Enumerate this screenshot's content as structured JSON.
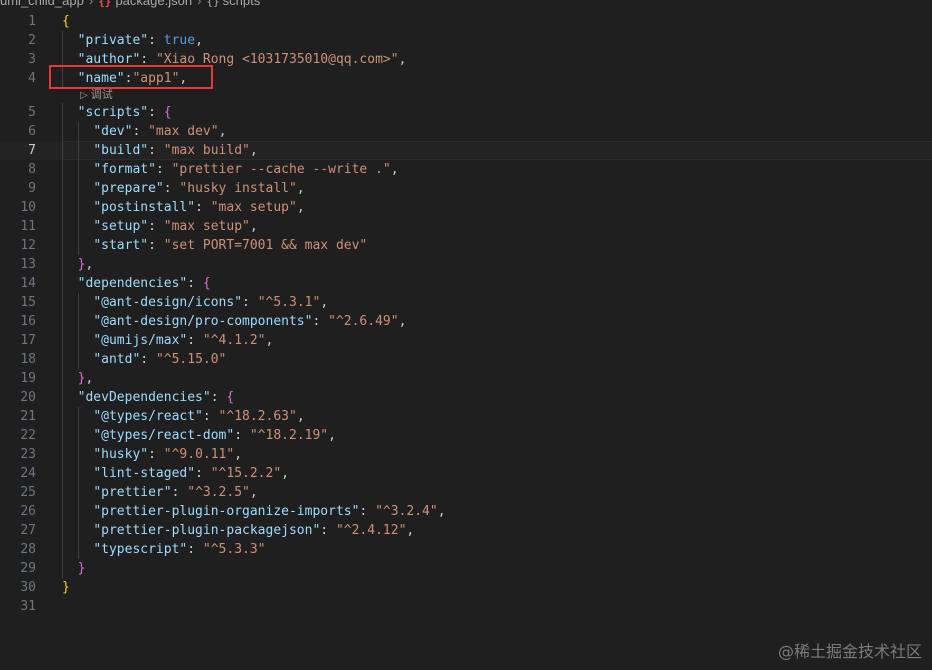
{
  "breadcrumb": {
    "folder": "umi_child_app",
    "file": "package.json",
    "symbol": "scripts"
  },
  "codelens": {
    "label": "调试"
  },
  "watermark": "@稀土掘金技术社区",
  "current_line": 7,
  "highlight_color": "#e53935",
  "lines": [
    {
      "n": "1",
      "html": "<span class='b1'>{</span>"
    },
    {
      "n": "2",
      "html": "  <span class='key'>\"private\"</span><span class='p'>: </span><span class='kw'>true</span><span class='p'>,</span>"
    },
    {
      "n": "3",
      "html": "  <span class='key'>\"author\"</span><span class='p'>: </span><span class='str'>\"Xiao Rong &lt;1031735010@qq.com&gt;\"</span><span class='p'>,</span>"
    },
    {
      "n": "4",
      "html": "  <span class='key'>\"name\"</span><span class='p'>:</span><span class='str'>\"app1\"</span><span class='p'>,</span>"
    },
    {
      "lens": true
    },
    {
      "n": "5",
      "html": "  <span class='key'>\"scripts\"</span><span class='p'>: </span><span class='b2'>{</span>"
    },
    {
      "n": "6",
      "html": "    <span class='key'>\"dev\"</span><span class='p'>: </span><span class='str'>\"max dev\"</span><span class='p'>,</span>"
    },
    {
      "n": "7",
      "html": "    <span class='key'>\"build\"</span><span class='p'>: </span><span class='str'>\"max build\"</span><span class='p'>,</span>"
    },
    {
      "n": "8",
      "html": "    <span class='key'>\"format\"</span><span class='p'>: </span><span class='str'>\"prettier --cache --write .\"</span><span class='p'>,</span>"
    },
    {
      "n": "9",
      "html": "    <span class='key'>\"prepare\"</span><span class='p'>: </span><span class='str'>\"husky install\"</span><span class='p'>,</span>"
    },
    {
      "n": "10",
      "html": "    <span class='key'>\"postinstall\"</span><span class='p'>: </span><span class='str'>\"max setup\"</span><span class='p'>,</span>"
    },
    {
      "n": "11",
      "html": "    <span class='key'>\"setup\"</span><span class='p'>: </span><span class='str'>\"max setup\"</span><span class='p'>,</span>"
    },
    {
      "n": "12",
      "html": "    <span class='key'>\"start\"</span><span class='p'>: </span><span class='str'>\"set PORT=7001 &amp;&amp; max dev\"</span>"
    },
    {
      "n": "13",
      "html": "  <span class='b2'>}</span><span class='p'>,</span>"
    },
    {
      "n": "14",
      "html": "  <span class='key'>\"dependencies\"</span><span class='p'>: </span><span class='b2'>{</span>"
    },
    {
      "n": "15",
      "html": "    <span class='key'>\"@ant-design/icons\"</span><span class='p'>: </span><span class='str'>\"^5.3.1\"</span><span class='p'>,</span>"
    },
    {
      "n": "16",
      "html": "    <span class='key'>\"@ant-design/pro-components\"</span><span class='p'>: </span><span class='str'>\"^2.6.49\"</span><span class='p'>,</span>"
    },
    {
      "n": "17",
      "html": "    <span class='key'>\"@umijs/max\"</span><span class='p'>: </span><span class='str'>\"^4.1.2\"</span><span class='p'>,</span>"
    },
    {
      "n": "18",
      "html": "    <span class='key'>\"antd\"</span><span class='p'>: </span><span class='str'>\"^5.15.0\"</span>"
    },
    {
      "n": "19",
      "html": "  <span class='b2'>}</span><span class='p'>,</span>"
    },
    {
      "n": "20",
      "html": "  <span class='key'>\"devDependencies\"</span><span class='p'>: </span><span class='b2'>{</span>"
    },
    {
      "n": "21",
      "html": "    <span class='key'>\"@types/react\"</span><span class='p'>: </span><span class='str'>\"^18.2.63\"</span><span class='p'>,</span>"
    },
    {
      "n": "22",
      "html": "    <span class='key'>\"@types/react-dom\"</span><span class='p'>: </span><span class='str'>\"^18.2.19\"</span><span class='p'>,</span>"
    },
    {
      "n": "23",
      "html": "    <span class='key'>\"husky\"</span><span class='p'>: </span><span class='str'>\"^9.0.11\"</span><span class='p'>,</span>"
    },
    {
      "n": "24",
      "html": "    <span class='key'>\"lint-staged\"</span><span class='p'>: </span><span class='str'>\"^15.2.2\"</span><span class='p'>,</span>"
    },
    {
      "n": "25",
      "html": "    <span class='key'>\"prettier\"</span><span class='p'>: </span><span class='str'>\"^3.2.5\"</span><span class='p'>,</span>"
    },
    {
      "n": "26",
      "html": "    <span class='key'>\"prettier-plugin-organize-imports\"</span><span class='p'>: </span><span class='str'>\"^3.2.4\"</span><span class='p'>,</span>"
    },
    {
      "n": "27",
      "html": "    <span class='key'>\"prettier-plugin-packagejson\"</span><span class='p'>: </span><span class='str'>\"^2.4.12\"</span><span class='p'>,</span>"
    },
    {
      "n": "28",
      "html": "    <span class='key'>\"typescript\"</span><span class='p'>: </span><span class='str'>\"^5.3.3\"</span>"
    },
    {
      "n": "29",
      "html": "  <span class='b2'>}</span>"
    },
    {
      "n": "30",
      "html": "<span class='b1'>}</span>"
    },
    {
      "n": "31",
      "html": ""
    }
  ]
}
